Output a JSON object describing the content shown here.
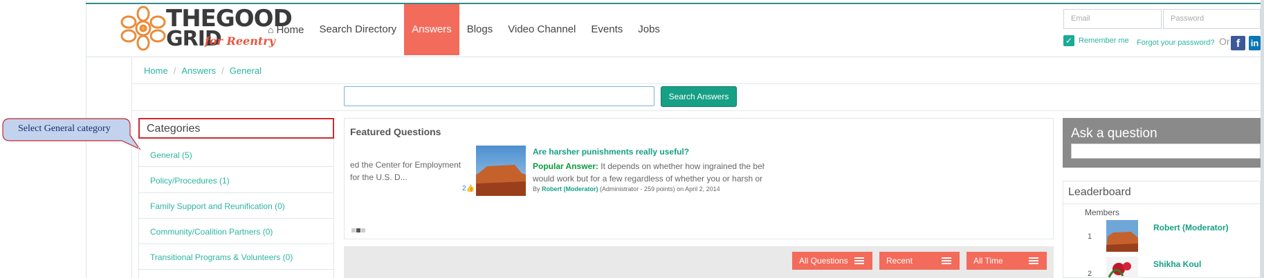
{
  "header": {
    "logo_line1": "THEGOOD",
    "logo_line2": "GRID",
    "logo_tagline": "for Reentry",
    "nav": [
      {
        "label": "Home",
        "icon": "home-icon"
      },
      {
        "label": "Search Directory"
      },
      {
        "label": "Answers",
        "active": true
      },
      {
        "label": "Blogs"
      },
      {
        "label": "Video Channel"
      },
      {
        "label": "Events"
      },
      {
        "label": "Jobs"
      }
    ],
    "login": {
      "email_placeholder": "Email",
      "password_placeholder": "Password",
      "remember_label": "Remember me",
      "forgot_label": "Forgot your password?",
      "or_label": "Or",
      "facebook_glyph": "f",
      "linkedin_glyph": "in"
    }
  },
  "breadcrumb": [
    "Home",
    "Answers",
    "General"
  ],
  "search": {
    "button_label": "Search Answers",
    "value": ""
  },
  "callout": {
    "text": "Select General category"
  },
  "categories": {
    "title": "Categories",
    "items": [
      "General (5)",
      "Policy/Procedures (1)",
      "Family Support and Reunification (0)",
      "Community/Coalition Partners (0)",
      "Transitional Programs & Volunteers (0)"
    ]
  },
  "featured": {
    "title": "Featured Questions",
    "prev_snippet_line1": "ed the Center for Employment",
    "prev_snippet_line2": "for the U.S. D...",
    "like_count": "2",
    "question": "Are harsher punishments really useful?",
    "popular_label": "Popular Answer:",
    "answer_line1": "It depends on whether how ingrained the beha",
    "answer_line2": "would work but for a few regardless of whether you or harsh or",
    "by_prefix": "By",
    "author": "Robert (Moderator)",
    "author_meta": "(Administrator - 259 points)",
    "date": "on April 2, 2014"
  },
  "tabs": [
    "All Questions",
    "Recent",
    "All Time"
  ],
  "ask": {
    "title": "Ask a question"
  },
  "leaderboard": {
    "title": "Leaderboard",
    "members_label": "Members",
    "rows": [
      {
        "rank": "1",
        "name": "Robert (Moderator)"
      },
      {
        "rank": "2",
        "name": "Shikha Koul"
      }
    ]
  },
  "colors": {
    "accent": "#16a085",
    "nav_active": "#f26b5b",
    "callout_border": "#d0282e"
  }
}
